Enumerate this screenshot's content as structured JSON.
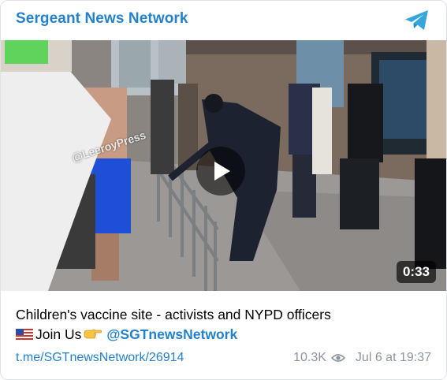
{
  "channel": {
    "name": "Sergeant News Network",
    "icon": "telegram-icon"
  },
  "video": {
    "duration": "0:33",
    "watermark": "@LeeroyPress",
    "play_icon": "play-icon"
  },
  "caption": {
    "line1": "Children's vaccine site - activists and NYPD officers",
    "flag_icon": "us-flag-icon",
    "line2_text": "Join Us",
    "pointing_icon": "pointing-hand-icon",
    "mention": "@SGTnewsNetwork"
  },
  "footer": {
    "link": "t.me/SGTnewsNetwork/26914",
    "views": "10.3K",
    "views_icon": "eye-icon",
    "date": "Jul 6 at 19:37"
  },
  "colors": {
    "accent": "#2481cc",
    "meta": "#8b95a0"
  }
}
